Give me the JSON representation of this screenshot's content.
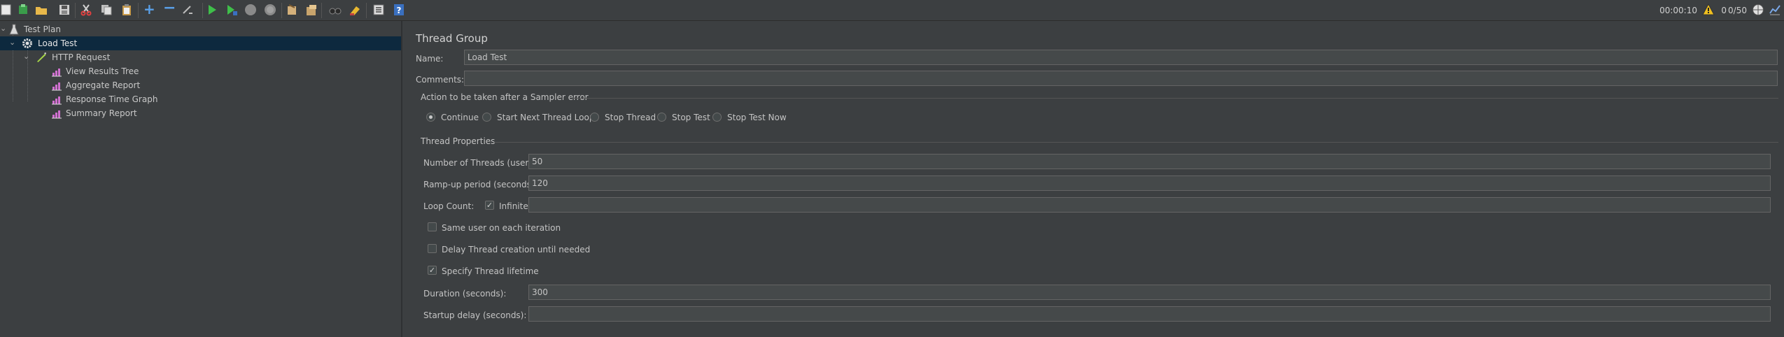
{
  "toolbar": {
    "timer": "00:00:10",
    "warning_count": "0",
    "threads": "0/50"
  },
  "tree": {
    "items": [
      {
        "label": "Test Plan",
        "icon": "test-plan-icon"
      },
      {
        "label": "Load Test",
        "icon": "thread-group-gear-icon"
      },
      {
        "label": "HTTP Request",
        "icon": "sampler-pen-icon"
      },
      {
        "label": "View Results Tree",
        "icon": "listener-graph-icon"
      },
      {
        "label": "Aggregate Report",
        "icon": "listener-graph-icon"
      },
      {
        "label": "Response Time Graph",
        "icon": "listener-graph-icon"
      },
      {
        "label": "Summary Report",
        "icon": "listener-graph-icon"
      }
    ]
  },
  "editor": {
    "title": "Thread Group",
    "name_label": "Name:",
    "name_value": "Load Test",
    "comments_label": "Comments:",
    "comments_value": "",
    "sampler_error": {
      "title": "Action to be taken after a Sampler error",
      "options": [
        "Continue",
        "Start Next Thread Loop",
        "Stop Thread",
        "Stop Test",
        "Stop Test Now"
      ],
      "selected": "Continue"
    },
    "thread_props": {
      "title": "Thread Properties",
      "threads_label": "Number of Threads (users):",
      "threads_value": "50",
      "rampup_label": "Ramp-up period (seconds):",
      "rampup_value": "120",
      "loop_label": "Loop Count:",
      "infinite_label": "Infinite",
      "infinite_checked": true,
      "loop_value": "",
      "same_user_label": "Same user on each iteration",
      "same_user_checked": false,
      "delay_label": "Delay Thread creation until needed",
      "delay_checked": false,
      "lifetime_label": "Specify Thread lifetime",
      "lifetime_checked": true,
      "duration_label": "Duration (seconds):",
      "duration_value": "300",
      "startup_label": "Startup delay (seconds):",
      "startup_value": ""
    }
  }
}
